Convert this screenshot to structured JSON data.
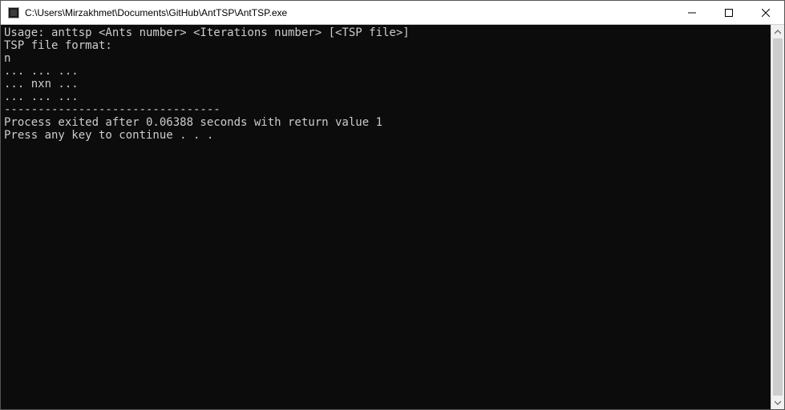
{
  "window": {
    "title": "C:\\Users\\Mirzakhmet\\Documents\\GitHub\\AntTSP\\AntTSP.exe"
  },
  "console": {
    "lines": [
      "Usage: anttsp <Ants number> <Iterations number> [<TSP file>]",
      "TSP file format:",
      "n",
      "... ... ...",
      "... nxn ...",
      "... ... ...",
      "--------------------------------",
      "Process exited after 0.06388 seconds with return value 1",
      "Press any key to continue . . ."
    ]
  }
}
